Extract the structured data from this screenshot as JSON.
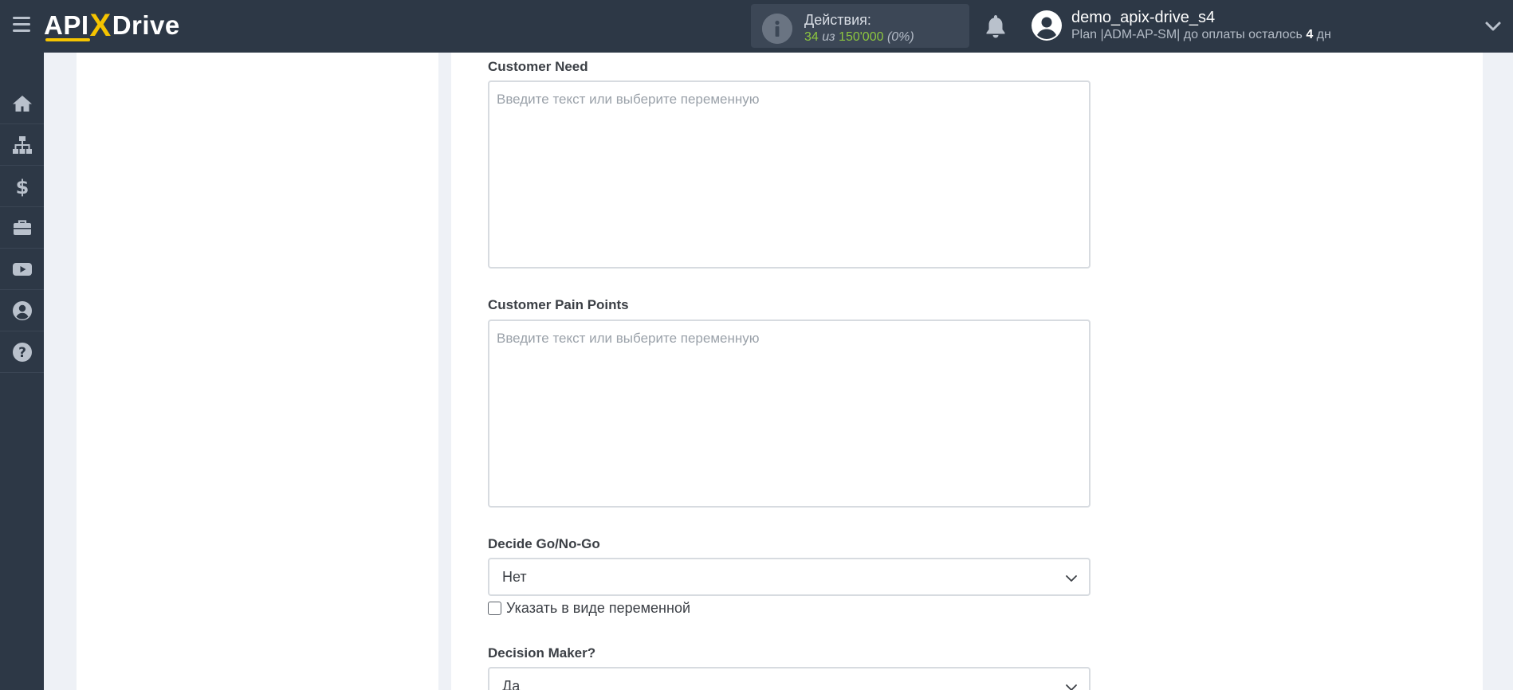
{
  "header": {
    "logo": {
      "api": "API",
      "x": "X",
      "drive": "Drive"
    },
    "actions": {
      "label": "Действия:",
      "used": "34",
      "of": "из",
      "total": "150'000",
      "percent": "(0%)"
    },
    "user": {
      "name": "demo_apix-drive_s4",
      "plan_prefix": "Plan |ADM-AP-SM| до оплаты осталось ",
      "days": "4",
      "days_suffix": " дн"
    }
  },
  "sidebar": {
    "items": [
      {
        "icon": "home-icon"
      },
      {
        "icon": "sitemap-icon"
      },
      {
        "icon": "dollar-icon"
      },
      {
        "icon": "briefcase-icon"
      },
      {
        "icon": "youtube-icon"
      },
      {
        "icon": "user-circle-icon"
      },
      {
        "icon": "question-icon"
      }
    ]
  },
  "form": {
    "customer_need": {
      "label": "Customer Need",
      "placeholder": "Введите текст или выберите переменную"
    },
    "customer_pain_points": {
      "label": "Customer Pain Points",
      "placeholder": "Введите текст или выберите переменную"
    },
    "decide_go_no_go": {
      "label": "Decide Go/No-Go",
      "value": "Нет",
      "checkbox_label": "Указать в виде переменной"
    },
    "decision_maker": {
      "label": "Decision Maker?",
      "value": "Да"
    }
  },
  "colors": {
    "topbar": "#2d3846",
    "accent_yellow": "#f5c400",
    "actions_green": "#8dc63f",
    "page_bg": "#eef1f6"
  }
}
